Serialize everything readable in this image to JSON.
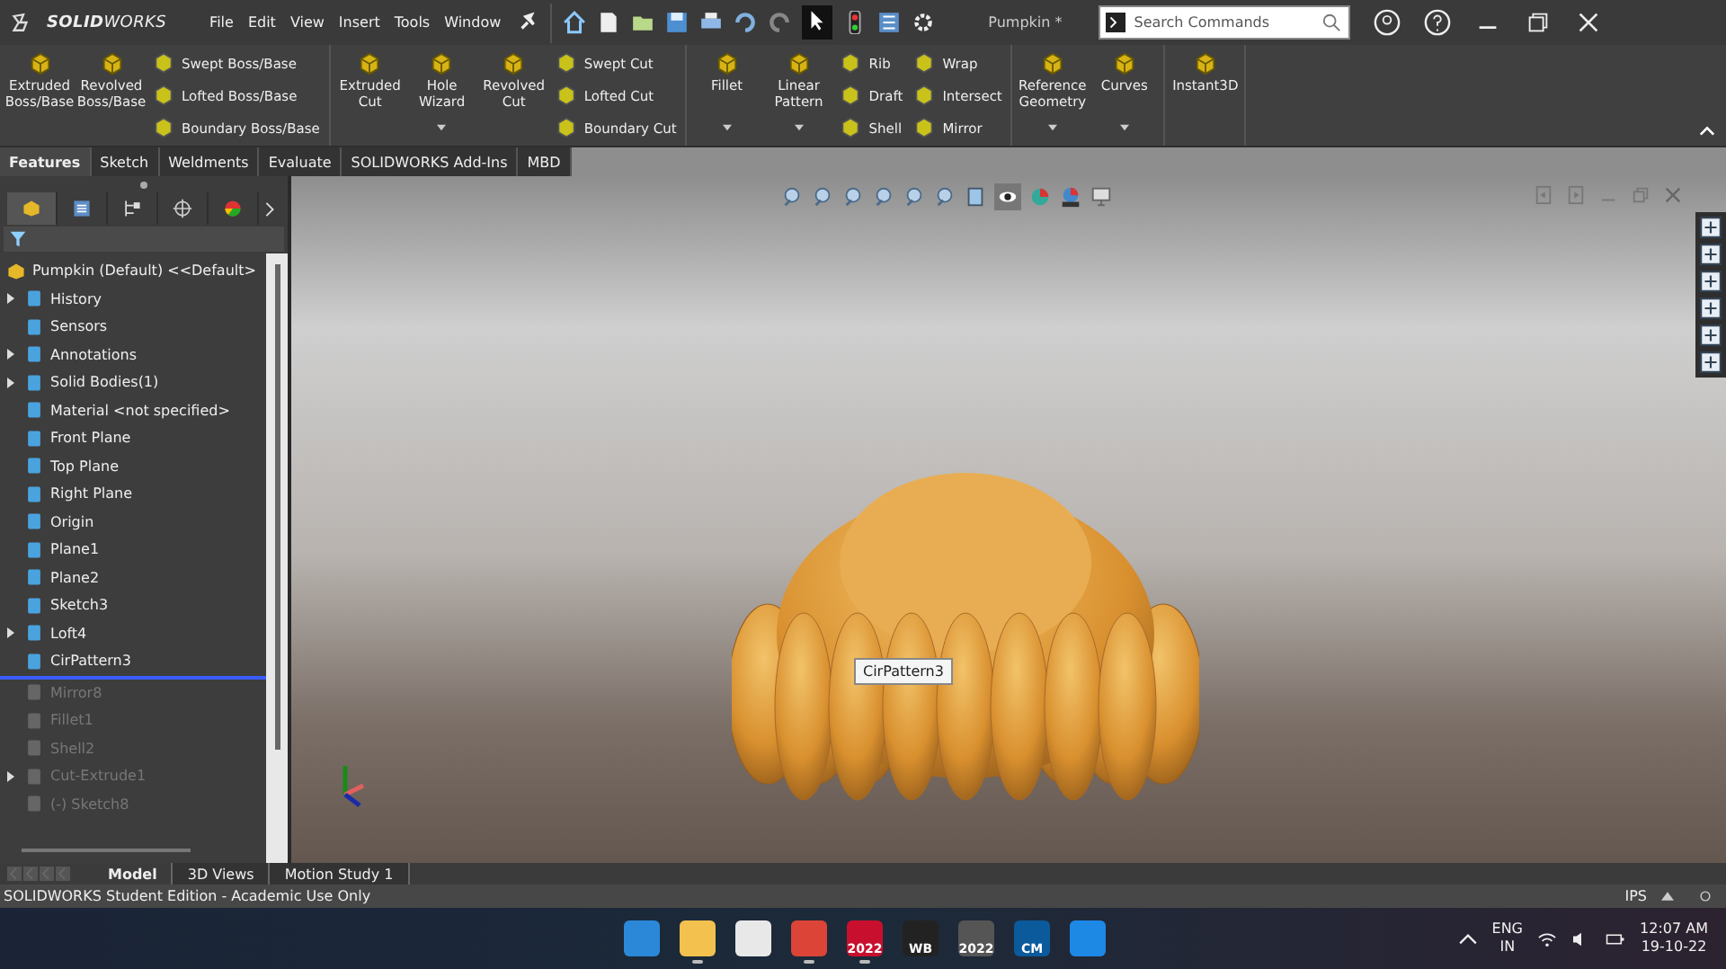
{
  "title_bar": {
    "logo": "**SOLID**WORKS",
    "menus": [
      "File",
      "Edit",
      "View",
      "Insert",
      "Tools",
      "Window"
    ],
    "document": "Pumpkin *",
    "search": {
      "placeholder": "Search Commands"
    }
  },
  "ribbon": {
    "groups": [
      {
        "items": [
          {
            "kind": "large",
            "label": "Extruded Boss/Base",
            "dropdown": false
          },
          {
            "kind": "large",
            "label": "Revolved Boss/Base",
            "dropdown": false
          },
          {
            "kind": "stack",
            "labels": [
              "Swept Boss/Base",
              "Lofted Boss/Base",
              "Boundary Boss/Base"
            ]
          }
        ]
      },
      {
        "items": [
          {
            "kind": "large",
            "label": "Extruded Cut",
            "dropdown": false
          },
          {
            "kind": "large",
            "label": "Hole Wizard",
            "dropdown": true
          },
          {
            "kind": "large",
            "label": "Revolved Cut",
            "dropdown": false
          },
          {
            "kind": "stack",
            "labels": [
              "Swept Cut",
              "Lofted Cut",
              "Boundary Cut"
            ]
          }
        ]
      },
      {
        "items": [
          {
            "kind": "large",
            "label": "Fillet",
            "dropdown": true
          },
          {
            "kind": "large",
            "label": "Linear Pattern",
            "dropdown": true
          },
          {
            "kind": "stack",
            "labels": [
              "Rib",
              "Draft",
              "Shell"
            ]
          },
          {
            "kind": "stack",
            "labels": [
              "Wrap",
              "Intersect",
              "Mirror"
            ]
          }
        ]
      },
      {
        "items": [
          {
            "kind": "large",
            "label": "Reference Geometry",
            "dropdown": true
          },
          {
            "kind": "large",
            "label": "Curves",
            "dropdown": true
          }
        ]
      },
      {
        "items": [
          {
            "kind": "large",
            "label": "Instant3D",
            "dropdown": false
          }
        ]
      }
    ]
  },
  "command_tabs": [
    {
      "label": "Features",
      "selected": true
    },
    {
      "label": "Sketch",
      "selected": false
    },
    {
      "label": "Weldments",
      "selected": false
    },
    {
      "label": "Evaluate",
      "selected": false
    },
    {
      "label": "SOLIDWORKS Add-Ins",
      "selected": false
    },
    {
      "label": "MBD",
      "selected": false
    }
  ],
  "feature_tree": {
    "root": "Pumpkin (Default) <<Default>",
    "items": [
      {
        "kind": "feature",
        "label": "History",
        "expandable": true,
        "disabled": false
      },
      {
        "kind": "feature",
        "label": "Sensors",
        "expandable": false,
        "disabled": false
      },
      {
        "kind": "feature",
        "label": "Annotations",
        "expandable": true,
        "disabled": false
      },
      {
        "kind": "feature",
        "label": "Solid Bodies(1)",
        "expandable": true,
        "disabled": false
      },
      {
        "kind": "feature",
        "label": "Material <not specified>",
        "expandable": false,
        "disabled": false
      },
      {
        "kind": "feature",
        "label": "Front Plane",
        "expandable": false,
        "disabled": false
      },
      {
        "kind": "feature",
        "label": "Top Plane",
        "expandable": false,
        "disabled": false
      },
      {
        "kind": "feature",
        "label": "Right Plane",
        "expandable": false,
        "disabled": false
      },
      {
        "kind": "feature",
        "label": "Origin",
        "expandable": false,
        "disabled": false
      },
      {
        "kind": "feature",
        "label": "Plane1",
        "expandable": false,
        "disabled": false
      },
      {
        "kind": "feature",
        "label": "Plane2",
        "expandable": false,
        "disabled": false
      },
      {
        "kind": "feature",
        "label": "Sketch3",
        "expandable": false,
        "disabled": false
      },
      {
        "kind": "feature",
        "label": "Loft4",
        "expandable": true,
        "disabled": false
      },
      {
        "kind": "feature",
        "label": "CirPattern3",
        "expandable": false,
        "disabled": false
      },
      {
        "kind": "rollback"
      },
      {
        "kind": "feature",
        "label": "Mirror8",
        "expandable": false,
        "disabled": true
      },
      {
        "kind": "feature",
        "label": "Fillet1",
        "expandable": false,
        "disabled": true
      },
      {
        "kind": "feature",
        "label": "Shell2",
        "expandable": false,
        "disabled": true
      },
      {
        "kind": "feature",
        "label": "Cut-Extrude1",
        "expandable": true,
        "disabled": true
      },
      {
        "kind": "feature",
        "label": "(-) Sketch8",
        "expandable": false,
        "disabled": true
      }
    ]
  },
  "viewport": {
    "tooltip": "CirPattern3"
  },
  "bottom_tabs": [
    {
      "label": "Model",
      "selected": true
    },
    {
      "label": "3D Views",
      "selected": false
    },
    {
      "label": "Motion Study 1",
      "selected": false
    }
  ],
  "status_bar": {
    "text": "SOLIDWORKS Student Edition - Academic Use Only",
    "units": "IPS"
  },
  "taskbar": {
    "apps": [
      {
        "running": false
      },
      {
        "running": true
      },
      {
        "running": false
      },
      {
        "running": true
      },
      {
        "label": "2022",
        "running": true
      },
      {
        "label": "WB",
        "running": false
      },
      {
        "label": "2022",
        "running": false
      },
      {
        "label": "CM",
        "running": false
      },
      {
        "running": false
      }
    ],
    "language": "ENG",
    "region": "IN",
    "time": "12:07 AM",
    "date": "19-10-22"
  }
}
